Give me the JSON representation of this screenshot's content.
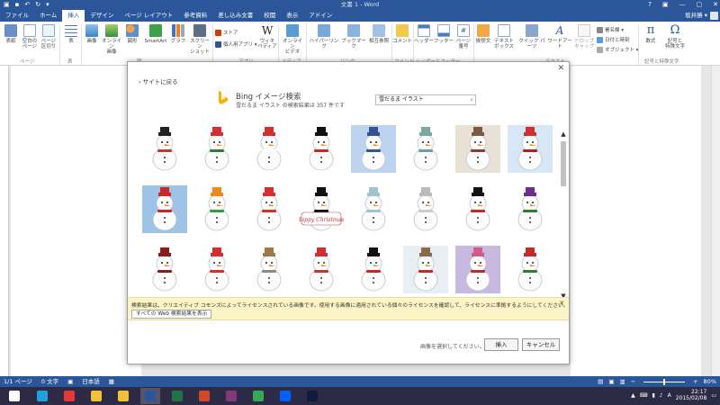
{
  "window": {
    "title": "文書 1 - Word",
    "controls": [
      "?",
      "▣",
      "—",
      "▢",
      "✕"
    ]
  },
  "tabs": [
    {
      "label": "ファイル",
      "kind": "file"
    },
    {
      "label": "ホーム"
    },
    {
      "label": "挿入",
      "active": true
    },
    {
      "label": "デザイン"
    },
    {
      "label": "ページ レイアウト"
    },
    {
      "label": "参考資料"
    },
    {
      "label": "差し込み文書"
    },
    {
      "label": "校閲"
    },
    {
      "label": "表示"
    },
    {
      "label": "アドイン"
    }
  ],
  "user": {
    "name": "坂井勝 ▾"
  },
  "ribbon": {
    "buttons": {
      "cover": "表紙",
      "blank": "空白の\nページ",
      "pagebreak": "ページ\n区切り",
      "table": "表",
      "picture": "画像",
      "online_picture": "オンライン\n画像",
      "shapes": "図形",
      "smartart": "SmartArt",
      "chart": "グラフ",
      "screenshot": "スクリーン\nショット",
      "wikipedia": "ウィキ\nペディア",
      "online_video": "オンライン\nビデオ",
      "comment": "コメント",
      "header": "ヘッダー",
      "footer": "フッター",
      "pagenum": "ページ\n番号",
      "textbox": "テキスト\nボックス",
      "quickparts": "クイック パーツ",
      "wordart": "ワードアート",
      "dropcap": "ドロップ\nキャップ",
      "equation": "数式",
      "symbol": "記号と\n特殊文字"
    },
    "small": {
      "store": "ストア",
      "myapps": "個人用アプリ ▾",
      "hyperlink": "ハイパーリンク",
      "bookmark": "ブックマーク",
      "crossref": "相互参照",
      "signature": "署名欄 ▾",
      "datetime": "日付と時刻",
      "object": "オブジェクト ▾",
      "greeting": "挨拶文"
    },
    "groups": {
      "pages": "ページ",
      "tables": "表",
      "illustrations": "図",
      "apps": "アプリ",
      "media": "メディア",
      "links": "リンク",
      "comments": "コメント",
      "headerfooter": "ヘッダーとフッター",
      "text": "テキスト",
      "symbols": "記号と特殊文字"
    },
    "icons": {
      "cover": "cover-page-icon",
      "table": "table-icon",
      "picture": "picture-icon",
      "shapes": "shapes-icon",
      "smartart": "smartart-icon",
      "chart": "chart-icon",
      "wikipedia": "wikipedia-icon",
      "equation": "pi-icon",
      "symbol": "omega-icon"
    }
  },
  "dialog": {
    "back": "‹ サイトに戻る",
    "title": "Bing イメージ検索",
    "subtitle": "雪だるま イラスト の検索結果は 357 件です",
    "search_value": "雪だるま イラスト",
    "notice": "検索結果は、クリエイティブ コモンズによってライセンスされている画像です。使用する画像に適用されている個々のライセンスを確認して、ライセンスに準拠するようにしてください。",
    "notice_button": "すべての Web 検索結果を表示",
    "prompt": "画像を選択してください。",
    "insert": "挿入",
    "cancel": "キャンセル",
    "close": "✕",
    "card_text": "Happy Christmas!",
    "thumbnails": [
      {
        "name": "snowman-blackhat-red-scarf",
        "bg": "#ffffff",
        "hat": "#222222",
        "scarf": "#c0392b"
      },
      {
        "name": "snowman-santa-hat",
        "bg": "#ffffff",
        "hat": "#d32f2f",
        "scarf": "#2e7d32"
      },
      {
        "name": "snowman-line-drawing",
        "bg": "#ffffff",
        "hat": "#d32f2f",
        "scarf": "#ffffff"
      },
      {
        "name": "snowman-tophat",
        "bg": "#ffffff",
        "hat": "#111111",
        "scarf": "#c62828"
      },
      {
        "name": "snowman-blue-night",
        "bg": "#bcd4ef",
        "hat": "#2f5597",
        "scarf": "#2f5597"
      },
      {
        "name": "snowman-teal-bucket",
        "bg": "#ffffff",
        "hat": "#78a9a3",
        "scarf": "#6aa39b"
      },
      {
        "name": "snowman-vintage",
        "bg": "#e8e2d6",
        "hat": "#7a5b3f",
        "scarf": "#8e3b2f"
      },
      {
        "name": "snowman-blue-frame",
        "bg": "#d7e7f6",
        "hat": "#d32f2f",
        "scarf": "#b71c1c"
      },
      {
        "name": "snowman-blue-sky",
        "bg": "#9ec3e6",
        "hat": "#c62828",
        "scarf": "#c62828"
      },
      {
        "name": "snowman-orange-bucket",
        "bg": "#ffffff",
        "hat": "#ef8a1a",
        "scarf": "#2e9e3a"
      },
      {
        "name": "snowman-santa-beard",
        "bg": "#ffffff",
        "hat": "#d32f2f",
        "scarf": "#d32f2f"
      },
      {
        "name": "snowman-penguin-card",
        "bg": "#ffffff",
        "hat": "#111111",
        "scarf": "#111111"
      },
      {
        "name": "snowman-light-blue",
        "bg": "#ffffff",
        "hat": "#9fc4cc",
        "scarf": "#9fc4cc"
      },
      {
        "name": "snowman-snowflakes",
        "bg": "#ffffff",
        "hat": "#bbbbbb",
        "scarf": "#cccccc"
      },
      {
        "name": "snowman-tophat-gift",
        "bg": "#ffffff",
        "hat": "#111111",
        "scarf": "#c62828"
      },
      {
        "name": "snowman-signboard",
        "bg": "#ffffff",
        "hat": "#6d2d8a",
        "scarf": "#2e7d32"
      },
      {
        "name": "snowman-red-body",
        "bg": "#ffffff",
        "hat": "#8a1c1c",
        "scarf": "#8a1c1c"
      },
      {
        "name": "snowman-red-knit",
        "bg": "#ffffff",
        "hat": "#d32f2f",
        "scarf": "#d32f2f"
      },
      {
        "name": "snowman-notepad",
        "bg": "#ffffff",
        "hat": "#a0784a",
        "scarf": "#888888"
      },
      {
        "name": "snowman-santa-hat-2",
        "bg": "#ffffff",
        "hat": "#d32f2f",
        "scarf": "#d32f2f"
      },
      {
        "name": "snowman-tophat-scarf",
        "bg": "#ffffff",
        "hat": "#111111",
        "scarf": "#c62828"
      },
      {
        "name": "snowman-village",
        "bg": "#e8eef3",
        "hat": "#8a6a4a",
        "scarf": "#c62828"
      },
      {
        "name": "snowman-girl-scene",
        "bg": "#c7b9e0",
        "hat": "#d35b8a",
        "scarf": "#c62828"
      },
      {
        "name": "snowman-green-scarf",
        "bg": "#ffffff",
        "hat": "#c62828",
        "scarf": "#2e7d32"
      }
    ]
  },
  "status": {
    "page": "1/1 ページ",
    "words": "0 文字",
    "lang": "日本語",
    "zoom": "80%",
    "zoom_fraction": 0.5
  },
  "taskbar": {
    "time": "22:17",
    "date": "2015/02/08",
    "apps": [
      {
        "name": "start-icon",
        "color": "#ffffff"
      },
      {
        "name": "ie-icon",
        "color": "#1fa0e0"
      },
      {
        "name": "chrome-icon",
        "color": "#e53935"
      },
      {
        "name": "explorer-icon",
        "color": "#f1c232"
      },
      {
        "name": "folder-icon",
        "color": "#f1c232"
      },
      {
        "name": "word-icon",
        "color": "#2b579a",
        "active": true
      },
      {
        "name": "excel-icon",
        "color": "#217346"
      },
      {
        "name": "powerpoint-icon",
        "color": "#d24726"
      },
      {
        "name": "onenote-icon",
        "color": "#80397b"
      },
      {
        "name": "drive-icon",
        "color": "#34a853"
      },
      {
        "name": "dropbox-icon",
        "color": "#0061fe"
      },
      {
        "name": "photoshop-icon",
        "color": "#0d1b3e"
      }
    ]
  },
  "colors": {
    "accent": "#2b579a",
    "notice_bg": "#fcf3c6",
    "bing": "#f4b400"
  }
}
